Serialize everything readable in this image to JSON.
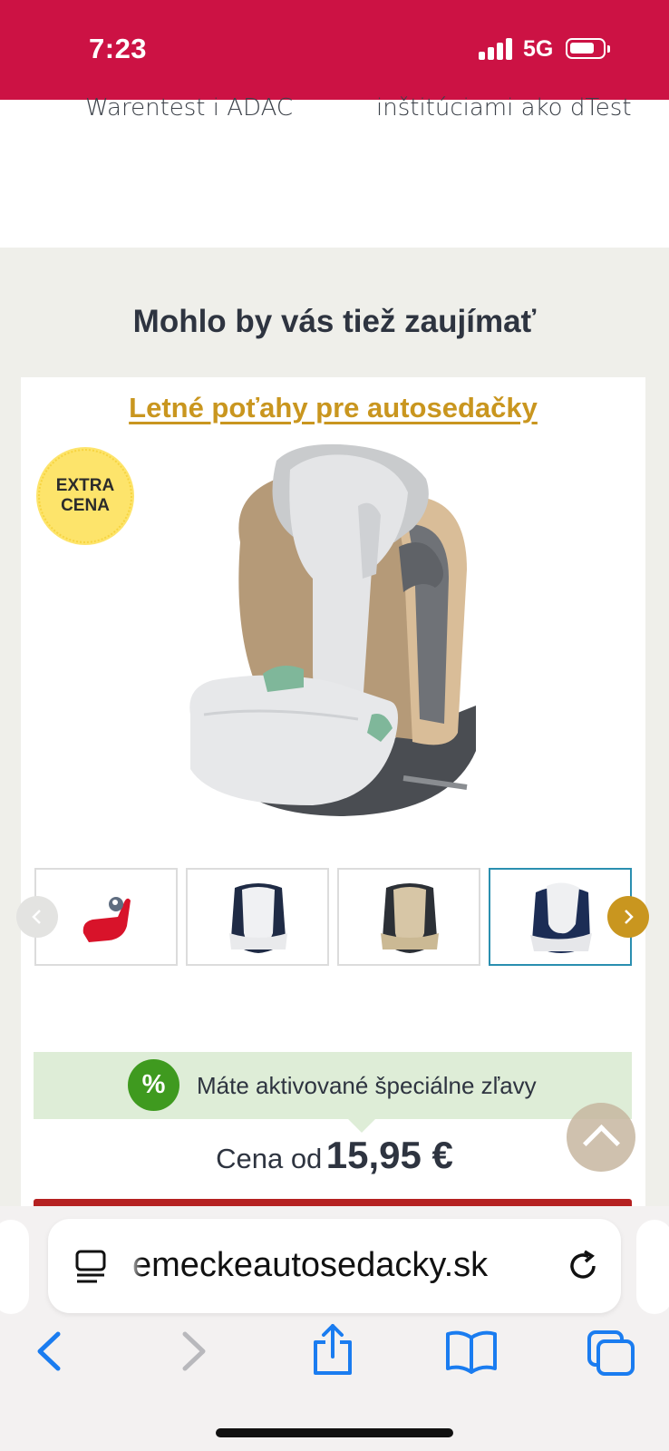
{
  "status_bar": {
    "time": "7:23",
    "network": "5G",
    "icons": [
      "signal-icon",
      "battery-icon"
    ],
    "battery_level": 0.65
  },
  "top_partial": {
    "left_text": "Warentest i ADAC",
    "right_text": "inštitúciami ako dTest"
  },
  "section": {
    "title": "Mohlo by vás tiež zaujímať"
  },
  "product": {
    "link_label": "Letné poťahy pre autosedačky",
    "badge_line1": "EXTRA",
    "badge_line2": "CENA",
    "thumbnails": [
      {
        "name": "thumb-red-seat",
        "active": false
      },
      {
        "name": "thumb-white-cover-navy-seat",
        "active": false
      },
      {
        "name": "thumb-beige-seat",
        "active": false
      },
      {
        "name": "thumb-white-cover-blue-seat",
        "active": true
      }
    ],
    "discount_text": "Máte aktivované špeciálne zľavy",
    "discount_icon": "%",
    "price_label": "Cena od",
    "price_value": "15,95 €"
  },
  "browser": {
    "url": "emeckeautosedacky.sk",
    "toolbar": [
      "back-icon",
      "forward-icon",
      "share-icon",
      "bookmarks-icon",
      "tabs-icon"
    ]
  },
  "colors": {
    "brand_red": "#cc1244",
    "accent_gold": "#c9961f",
    "discount_green": "#3f9a1f",
    "ios_blue": "#1a7cf0"
  }
}
